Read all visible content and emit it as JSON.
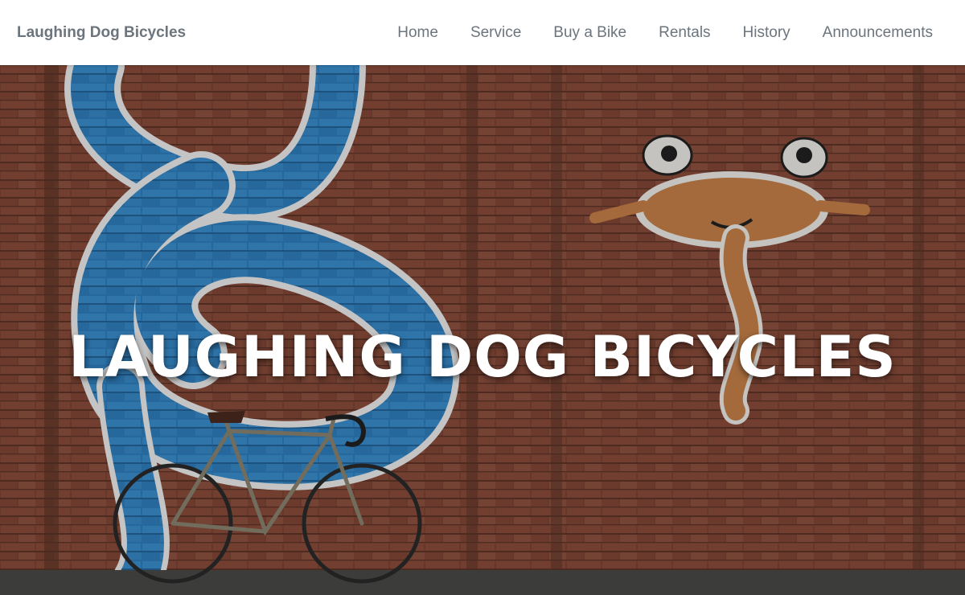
{
  "navbar": {
    "brand": "Laughing Dog Bicycles",
    "links": [
      {
        "label": "Home"
      },
      {
        "label": "Service"
      },
      {
        "label": "Buy a Bike"
      },
      {
        "label": "Rentals"
      },
      {
        "label": "History"
      },
      {
        "label": "Announcements"
      }
    ]
  },
  "hero": {
    "title": "LAUGHING DOG BICYCLES",
    "background_description_colors": {
      "brick": "#7a4434",
      "mural_blue": "#3a8ccc",
      "mural_orange": "#c8824a"
    }
  }
}
